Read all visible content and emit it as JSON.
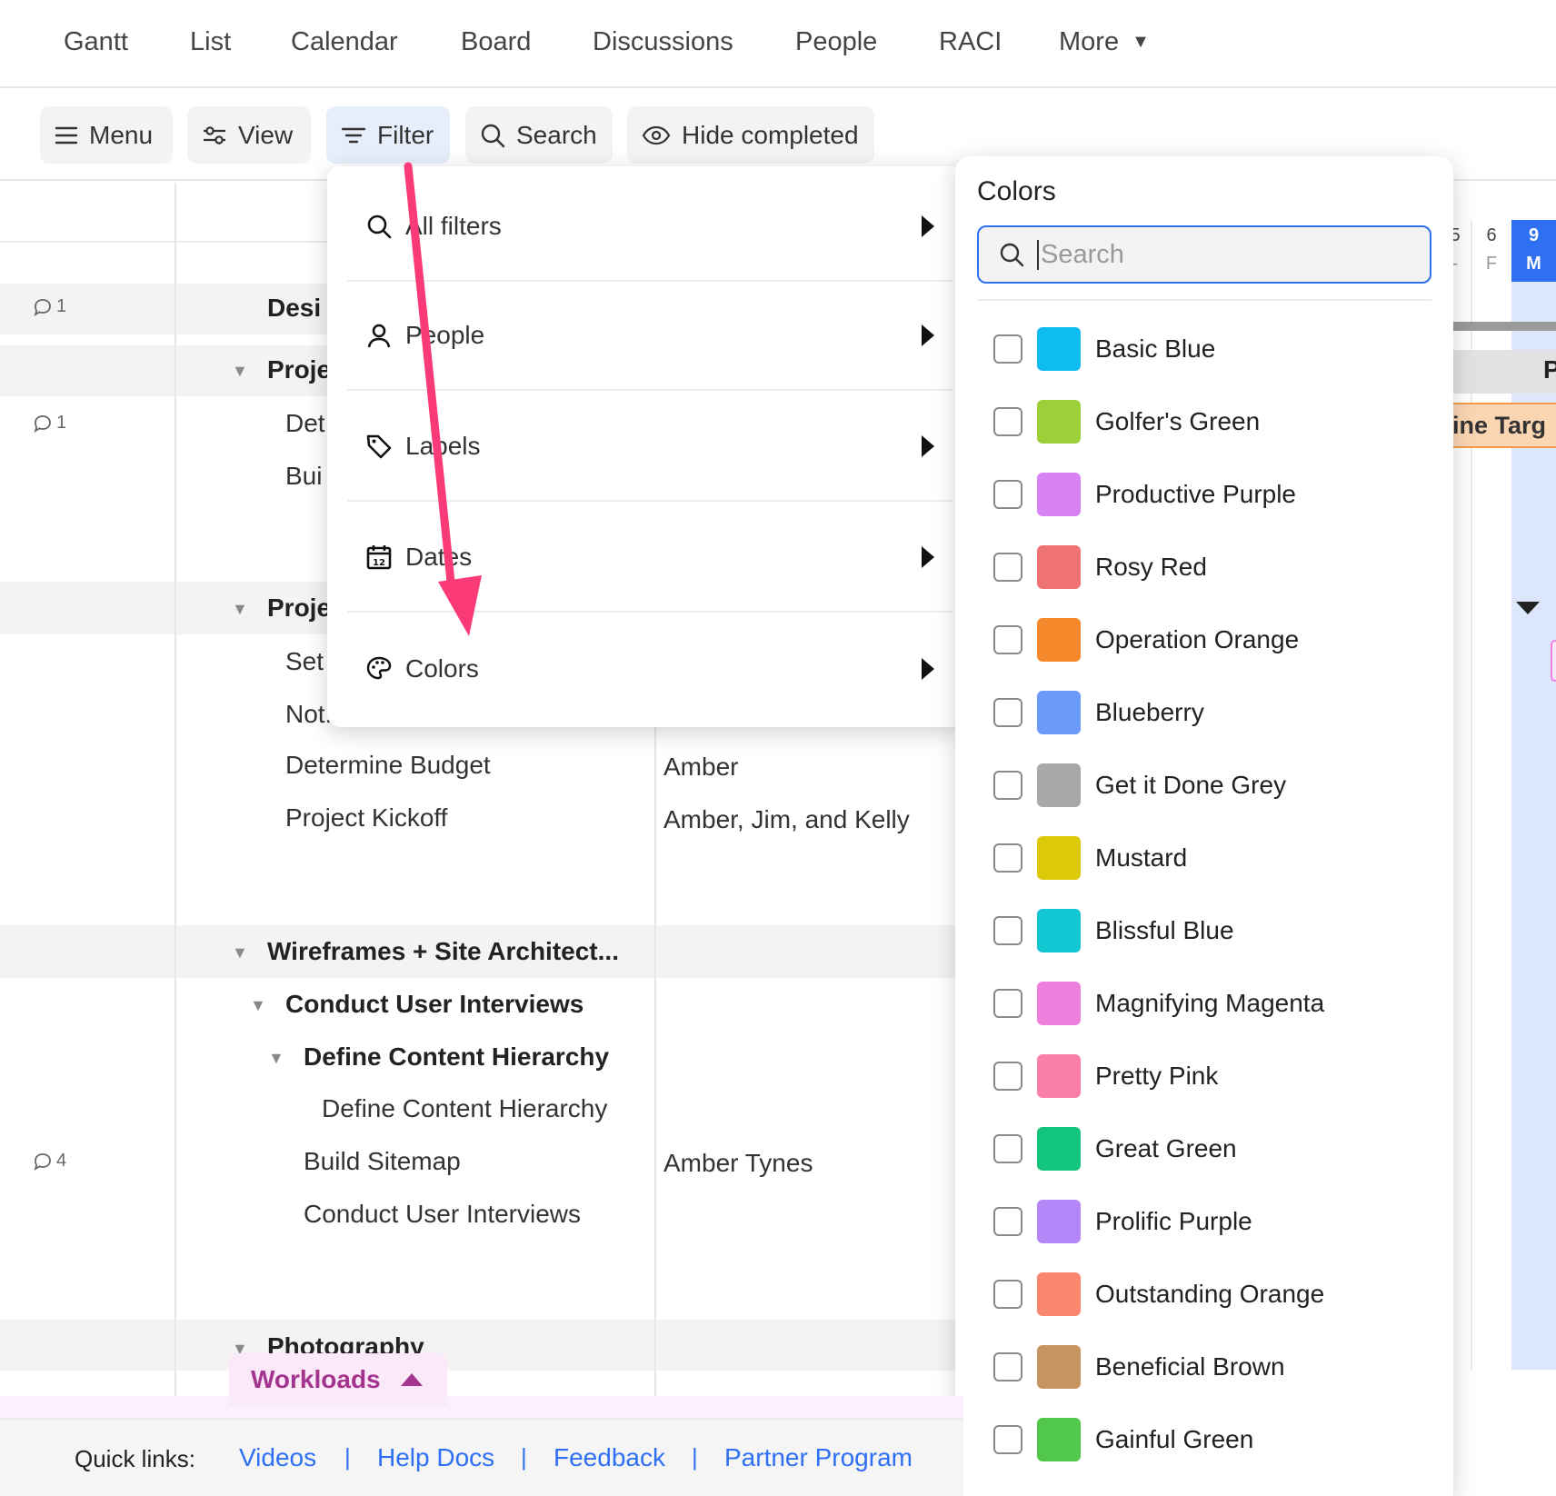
{
  "topnav": {
    "tabs": [
      "Gantt",
      "List",
      "Calendar",
      "Board",
      "Discussions",
      "People",
      "RACI",
      "More"
    ]
  },
  "toolbar": {
    "menu": "Menu",
    "view": "View",
    "filter": "Filter",
    "search": "Search",
    "hide_completed": "Hide completed"
  },
  "grid": {
    "rows": {
      "desi": "Desi",
      "proje1": "Proje",
      "det": "Det",
      "bui": "Bui",
      "proje2": "Proje",
      "set": "Set",
      "not": "Not.",
      "determine_budget": "Determine Budget",
      "project_kickoff": "Project Kickoff",
      "wireframes": "Wireframes + Site Architect...",
      "conduct_ui_group": "Conduct User Interviews",
      "define_ch_group": "Define Content Hierarchy",
      "define_ch_task": "Define Content Hierarchy",
      "build_sitemap": "Build Sitemap",
      "conduct_ui_task": "Conduct User Interviews",
      "photography": "Photography"
    },
    "assignees": {
      "determine_budget": "Amber",
      "project_kickoff": "Amber, Jim, and Kelly",
      "build_sitemap": "Amber Tynes"
    },
    "comments": {
      "row1": "1",
      "row2": "1",
      "row3": "4"
    }
  },
  "gantt": {
    "days": [
      {
        "num": "5",
        "letter": "-"
      },
      {
        "num": "6",
        "letter": "F"
      },
      {
        "num": "9",
        "letter": "M"
      }
    ],
    "partial_letter": "P",
    "pill_text": "ine Targ"
  },
  "filter_menu": {
    "items": [
      "All filters",
      "People",
      "Labels",
      "Dates",
      "Colors"
    ]
  },
  "colors_panel": {
    "title": "Colors",
    "search_placeholder": "Search",
    "options": [
      {
        "name": "Basic Blue",
        "color": "#0ebcef"
      },
      {
        "name": "Golfer's Green",
        "color": "#9ccf3a"
      },
      {
        "name": "Productive Purple",
        "color": "#d783f5"
      },
      {
        "name": "Rosy Red",
        "color": "#ef7373"
      },
      {
        "name": "Operation Orange",
        "color": "#f6892b"
      },
      {
        "name": "Blueberry",
        "color": "#6b9bfa"
      },
      {
        "name": "Get it Done Grey",
        "color": "#a8a8a8"
      },
      {
        "name": "Mustard",
        "color": "#dcc90a"
      },
      {
        "name": "Blissful Blue",
        "color": "#12c6d2"
      },
      {
        "name": "Magnifying Magenta",
        "color": "#ee80dd"
      },
      {
        "name": "Pretty Pink",
        "color": "#fb7fa9"
      },
      {
        "name": "Great Green",
        "color": "#12c47d"
      },
      {
        "name": "Prolific Purple",
        "color": "#b586f7"
      },
      {
        "name": "Outstanding Orange",
        "color": "#fb866e"
      },
      {
        "name": "Beneficial Brown",
        "color": "#c79360"
      },
      {
        "name": "Gainful Green",
        "color": "#52c84a"
      }
    ]
  },
  "workloads": {
    "label": "Workloads"
  },
  "footer": {
    "quick_links_label": "Quick links:",
    "links": [
      "Videos",
      "Help Docs",
      "Feedback",
      "Partner Program"
    ],
    "separator": "|"
  },
  "colors": {
    "accent": "#2f6ff2",
    "annotation": "#fb3a78"
  }
}
